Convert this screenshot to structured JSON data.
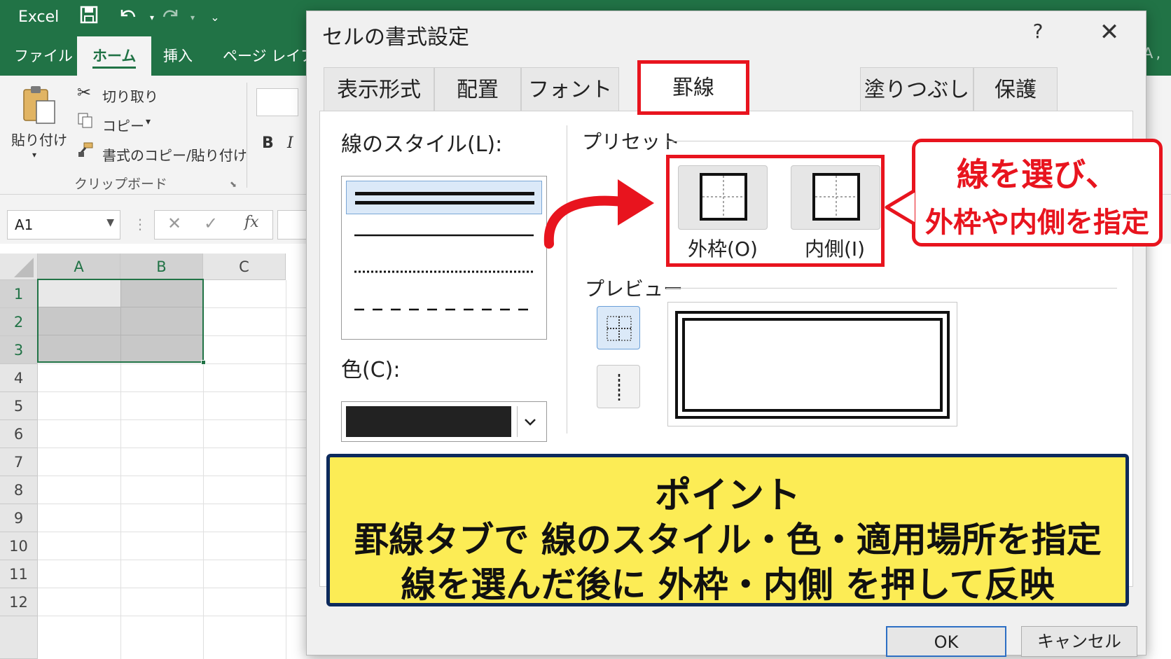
{
  "excel": {
    "app_name": "Excel",
    "menu_tabs": [
      "ファイル",
      "ホーム",
      "挿入",
      "ページ レイアウ"
    ],
    "active_tab": "ホーム",
    "ribbon": {
      "paste": "貼り付け",
      "cut": "切り取り",
      "copy": "コピー",
      "format_painter": "書式のコピー/貼り付け",
      "group": "クリップボード",
      "bold": "B",
      "italic": "I"
    },
    "name_box": "A1",
    "fx": "fx",
    "columns": [
      "A",
      "B",
      "C"
    ],
    "rows": [
      "1",
      "2",
      "3",
      "4",
      "5",
      "6",
      "7",
      "8",
      "9",
      "10",
      "11",
      "12"
    ],
    "right_cut_text": "A ,"
  },
  "dialog": {
    "title": "セルの書式設定",
    "help": "?",
    "close": "✕",
    "tabs": [
      "表示形式",
      "配置",
      "フォント",
      "罫線",
      "塗りつぶし",
      "保護"
    ],
    "active_tab": "罫線",
    "line_style_label": "線のスタイル(L):",
    "color_label": "色(C):",
    "color_value": "#222222",
    "preset_label": "プリセット",
    "preset_outline": "外枠(O)",
    "preset_inside": "内側(I)",
    "preview_label": "プレビュー",
    "ok": "OK",
    "cancel": "キャンセル"
  },
  "callout": {
    "line1": "線を選び、",
    "line2": "外枠や内側を指定",
    "color": "#e8141e"
  },
  "point": {
    "title": "ポイント",
    "line1": "罫線タブで 線のスタイル・色・適用場所を指定",
    "line2": "線を選んだ後に 外枠・内側 を押して反映",
    "bg": "#fcec55",
    "border": "#0d2a5c"
  }
}
